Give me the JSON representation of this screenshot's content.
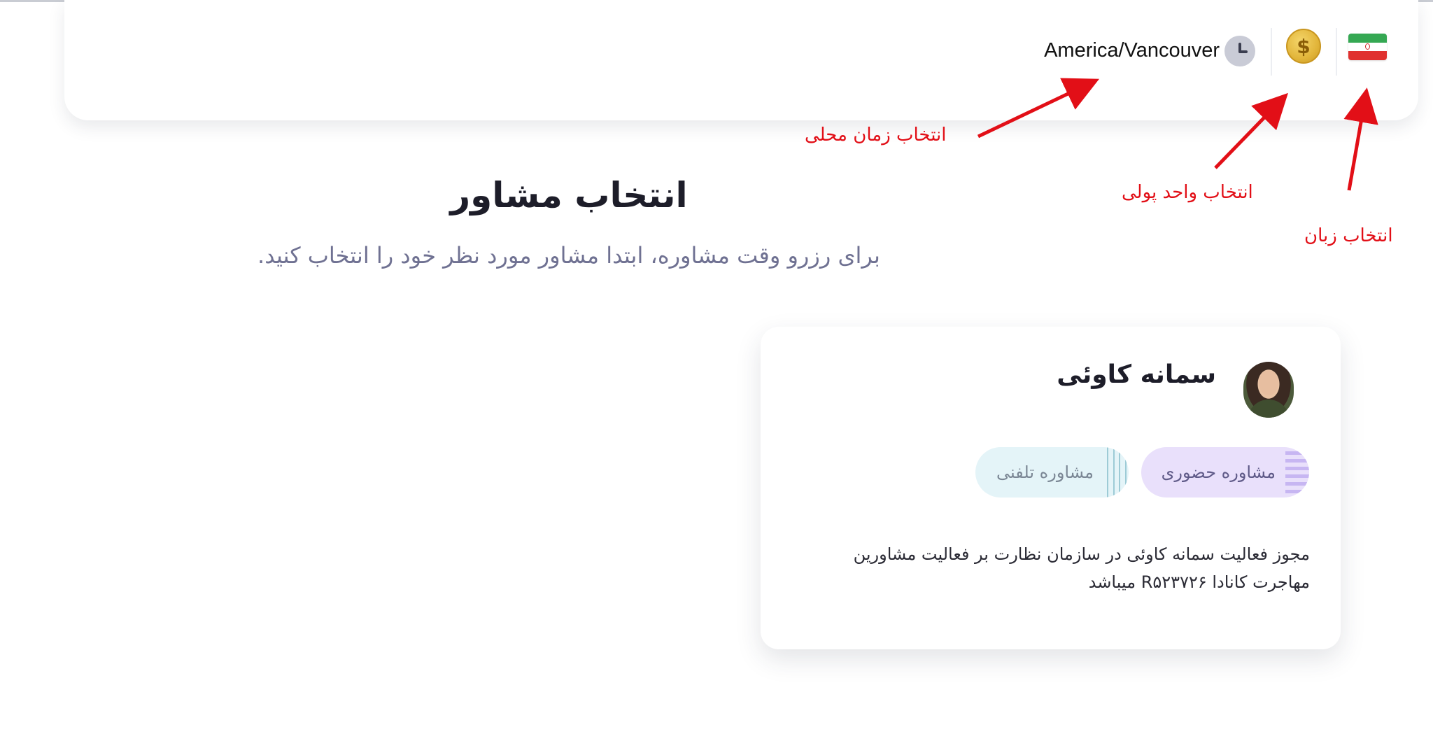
{
  "header": {
    "timezone": "America/Vancouver",
    "currency_symbol": "$",
    "language_flag": "iran-flag-icon"
  },
  "annotations": {
    "timezone": "انتخاب زمان محلی",
    "currency": "انتخاب واحد پولی",
    "language": "انتخاب زبان"
  },
  "main": {
    "title": "انتخاب مشاور",
    "subtitle": "برای رزرو وقت مشاوره، ابتدا مشاور مورد نظر خود را انتخاب کنید."
  },
  "advisor": {
    "name": "سمانه کاوئی",
    "tags": [
      "مشاوره حضوری",
      "مشاوره تلفنی"
    ],
    "description": "مجوز فعالیت سمانه کاوئی در سازمان نظارت بر فعالیت مشاورین مهاجرت کانادا R۵۲۳۷۲۶ میباشد"
  },
  "colors": {
    "annotation": "#e20f17",
    "in_person_chip": "#e9e0fb",
    "phone_chip": "#e4f4f8"
  }
}
